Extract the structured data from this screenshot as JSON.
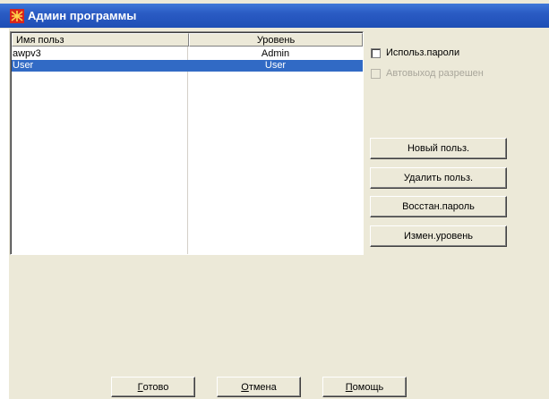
{
  "window": {
    "title": "Админ программы",
    "icon": "app-flag-icon",
    "titlebar_color": "#2a5bc4",
    "background": "#ece9d8"
  },
  "users_table": {
    "columns": [
      "Имя польз",
      "Уровень"
    ],
    "rows": [
      {
        "name": "awpv3",
        "level": "Admin",
        "selected": false
      },
      {
        "name": "User",
        "level": "User",
        "selected": true
      }
    ],
    "selection_color": "#316ac5"
  },
  "options": {
    "use_passwords": {
      "label": "Использ.пароли",
      "checked": false,
      "enabled": true
    },
    "auto_logout": {
      "label": "Автовыход разрешен",
      "checked": false,
      "enabled": false
    }
  },
  "side_buttons": {
    "new_user": "Новый польз.",
    "delete_user": "Удалить польз.",
    "restore_password": "Восстан.пароль",
    "change_level": "Измен.уровень"
  },
  "bottom_buttons": {
    "ok": {
      "mnemonic": "Г",
      "rest": "отово"
    },
    "cancel": {
      "mnemonic": "О",
      "rest": "тмена"
    },
    "help": {
      "mnemonic": "П",
      "rest": "омощь"
    }
  }
}
